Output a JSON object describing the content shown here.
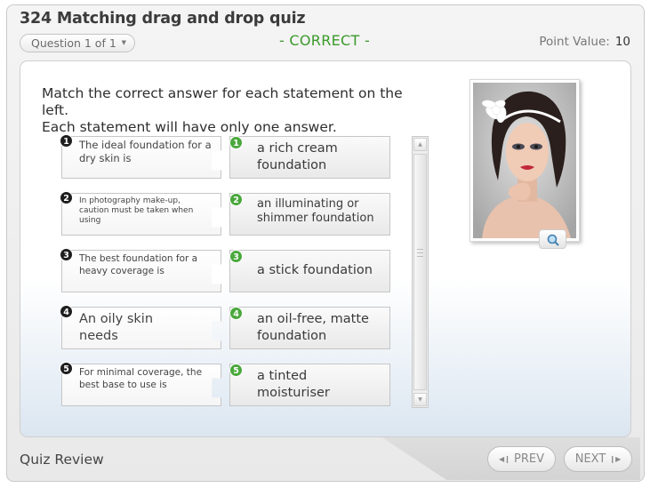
{
  "header": {
    "quiz_title": "324 Matching drag and drop quiz",
    "question_selector": "Question 1 of 1",
    "result": "- CORRECT -",
    "point_value_label": "Point Value:",
    "point_value": "10"
  },
  "instructions": {
    "line1": "Match the correct answer for each statement on the left.",
    "line2": "Each statement will have only one answer."
  },
  "pairs": [
    {
      "statement_num": "1",
      "statement": "The ideal foundation for a dry skin is",
      "answer_num": "1",
      "answer": "a rich cream foundation"
    },
    {
      "statement_num": "2",
      "statement": "In photography make-up, caution must be taken when using",
      "answer_num": "2",
      "answer": "an illuminating or shimmer foundation"
    },
    {
      "statement_num": "3",
      "statement": "The best foundation for a heavy coverage is",
      "answer_num": "3",
      "answer": "a stick foundation"
    },
    {
      "statement_num": "4",
      "statement": "An oily skin needs",
      "answer_num": "4",
      "answer": "an oil-free, matte foundation"
    },
    {
      "statement_num": "5",
      "statement": "For minimal coverage, the best base to use is",
      "answer_num": "5",
      "answer": "a tinted moisturiser"
    }
  ],
  "footer": {
    "label": "Quiz Review",
    "prev_label": "PREV",
    "next_label": "NEXT"
  },
  "colors": {
    "correct_green": "#3a9a2a",
    "badge_green": "#4aa83c",
    "badge_dark": "#1e1e1e"
  },
  "icons": {
    "zoom": "magnifier-icon",
    "prev": "prev-arrow-icon",
    "next": "next-arrow-icon"
  }
}
